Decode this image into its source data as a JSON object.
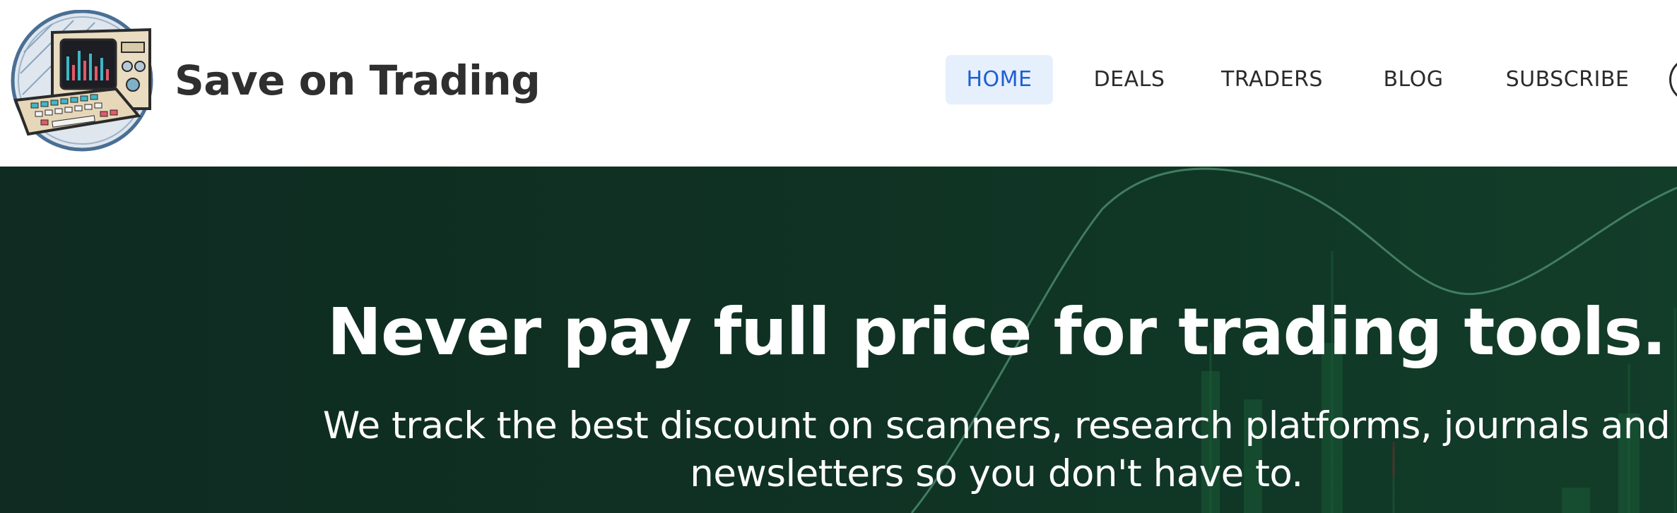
{
  "brand": {
    "name": "Save on Trading",
    "logo_icon": "retro-computer-icon"
  },
  "nav": {
    "items": [
      {
        "label": "HOME",
        "active": true
      },
      {
        "label": "DEALS",
        "active": false
      },
      {
        "label": "TRADERS",
        "active": false
      },
      {
        "label": "BLOG",
        "active": false
      },
      {
        "label": "SUBSCRIBE",
        "active": false
      }
    ],
    "overflow_icon": "account-circle-icon"
  },
  "hero": {
    "title": "Never pay full price for trading tools.",
    "subtitle": "We track the best discount on scanners, research platforms, journals and newsletters so you don't have to."
  },
  "colors": {
    "nav_active_bg": "#e6effc",
    "nav_active_text": "#1f5fd1",
    "hero_bg": "#0f2b22",
    "hero_text": "#ffffff"
  }
}
